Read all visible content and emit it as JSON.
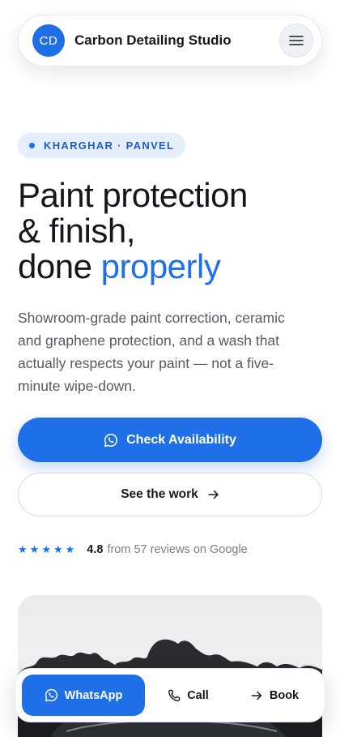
{
  "header": {
    "logo_text": "CD",
    "brand_name": "Carbon Detailing Studio",
    "menu_icon": "hamburger-icon"
  },
  "hero": {
    "location_badge": "KHARGHAR · PANVEL",
    "headline_line1": "Paint protection",
    "headline_line2": "& finish,",
    "headline_line3": "done",
    "headline_accent": "properly",
    "description": "Showroom-grade paint correction, ceramic and graphene protection, and a wash that actually respects your paint — not a five-minute wipe-down.",
    "primary_cta": "Check Availability",
    "secondary_cta": "See the work"
  },
  "rating": {
    "stars": 5,
    "score": "4.8",
    "text": "from 57 reviews on Google"
  },
  "bottom_bar": {
    "whatsapp_label": "WhatsApp",
    "call_label": "Call",
    "book_label": "Book"
  },
  "colors": {
    "accent": "#1f6fe8",
    "badge_bg": "#e5effc"
  }
}
